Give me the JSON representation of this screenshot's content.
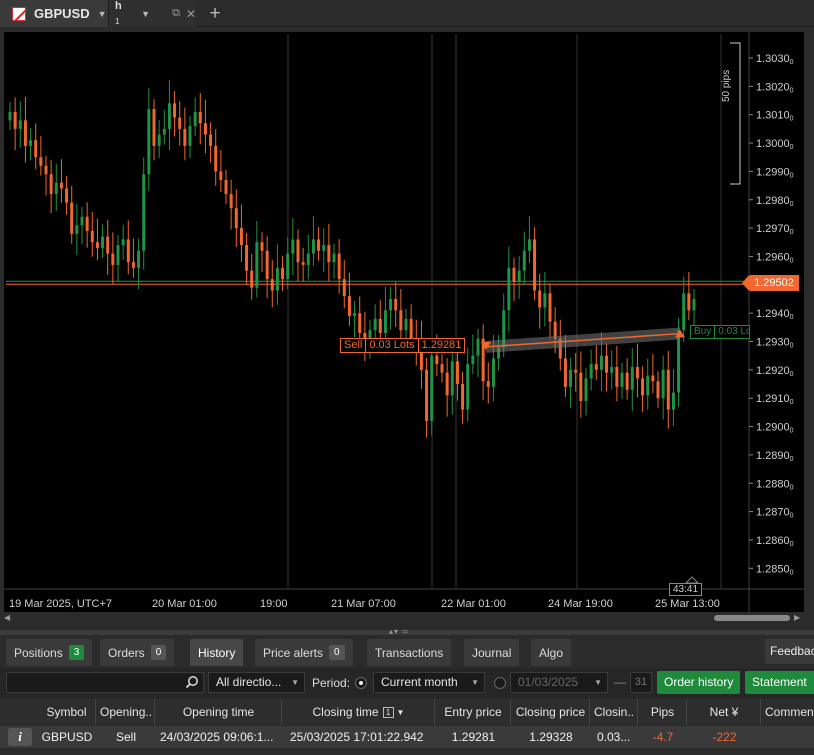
{
  "window": {
    "symbol_tab": "GBPUSD",
    "timeframe": "h",
    "timeframe_sub": "1"
  },
  "chart": {
    "current_price": "1.29502",
    "y_axis_labels": [
      "1.30300",
      "1.30200",
      "1.30100",
      "1.30000",
      "1.29900",
      "1.29800",
      "1.29700",
      "1.29600",
      "1.29500",
      "1.29400",
      "1.29300",
      "1.29200",
      "1.29100",
      "1.29000",
      "1.28900",
      "1.28800",
      "1.28700",
      "1.28600",
      "1.28500"
    ],
    "x_axis_labels": [
      "19 Mar 2025, UTC+7",
      "20 Mar 01:00",
      "19:00",
      "21 Mar 07:00",
      "22 Mar 01:00",
      "24 Mar 19:00",
      "25 Mar 13:00"
    ],
    "pips_ruler": "50 pips",
    "cursor_time": "43:41",
    "sell_marker": {
      "side": "Sell",
      "lots": "0.03 Lots",
      "price": "1.29281"
    },
    "buy_marker": {
      "side": "Buy",
      "lots": "0.03 Lo"
    },
    "colors": {
      "bull": "#1f9447",
      "bear": "#f06830",
      "background": "#000000",
      "grid": "#333333"
    }
  },
  "chart_data": {
    "type": "candlestick",
    "ylim": [
      1.2845,
      1.3035
    ],
    "current_price": 1.29502,
    "trade": {
      "entry_price": 1.29281,
      "closing_price": 1.29328,
      "entry_time": "24/03/2025 09:06",
      "closing_time": "25/03/2025 17:01"
    },
    "candles_close": [
      1.3011,
      1.3005,
      1.3008,
      1.2999,
      1.3001,
      1.2995,
      1.2992,
      1.2989,
      1.2982,
      1.2986,
      1.2984,
      1.2979,
      1.2968,
      1.2971,
      1.2974,
      1.2969,
      1.2965,
      1.2963,
      1.2967,
      1.2961,
      1.2957,
      1.2964,
      1.2966,
      1.2958,
      1.2956,
      1.2962,
      1.2989,
      1.3012,
      1.2999,
      1.3003,
      1.3005,
      1.3014,
      1.3009,
      1.3005,
      1.2999,
      1.3006,
      1.3011,
      1.3007,
      1.3003,
      1.2999,
      1.299,
      1.2987,
      1.2982,
      1.2977,
      1.297,
      1.2964,
      1.2955,
      1.2949,
      1.2965,
      1.2962,
      1.2952,
      1.2948,
      1.2956,
      1.2952,
      1.2961,
      1.2966,
      1.2958,
      1.2957,
      1.2961,
      1.2966,
      1.2962,
      1.2964,
      1.2958,
      1.2961,
      1.2952,
      1.2946,
      1.2939,
      1.294,
      1.2933,
      1.2929,
      1.2934,
      1.2938,
      1.2933,
      1.2941,
      1.2945,
      1.2941,
      1.2934,
      1.2938,
      1.2931,
      1.2929,
      1.292,
      1.2902,
      1.2925,
      1.2922,
      1.2919,
      1.2911,
      1.2923,
      1.2915,
      1.2906,
      1.2922,
      1.2925,
      1.2931,
      1.2916,
      1.2914,
      1.2924,
      1.2928,
      1.2941,
      1.2956,
      1.2951,
      1.2955,
      1.2962,
      1.2966,
      1.2948,
      1.2942,
      1.2947,
      1.2937,
      1.2931,
      1.2924,
      1.2914,
      1.292,
      1.2919,
      1.2909,
      1.2917,
      1.2922,
      1.292,
      1.2925,
      1.2919,
      1.2921,
      1.2914,
      1.2919,
      1.2913,
      1.2921,
      1.2917,
      1.2911,
      1.2918,
      1.2916,
      1.291,
      1.292,
      1.2906,
      1.2912,
      1.2934,
      1.2947,
      1.2941,
      1.2945
    ]
  },
  "bottom_tabs": [
    {
      "label": "Positions",
      "badge": "3"
    },
    {
      "label": "Orders",
      "badge": "0"
    },
    {
      "label": "History"
    },
    {
      "label": "Price alerts",
      "badge": "0"
    },
    {
      "label": "Transactions"
    },
    {
      "label": "Journal"
    },
    {
      "label": "Algo"
    }
  ],
  "feedback_label": "Feedbac",
  "filters": {
    "search_value": "",
    "direction": "All directio...",
    "period_label": "Period:",
    "period_value": "Current month",
    "date_from": "01/03/2025",
    "date_sep": "—",
    "calendar": "31",
    "order_history_btn": "Order history",
    "statement_btn": "Statement"
  },
  "table": {
    "headers": [
      "Symbol",
      "Opening..",
      "Opening time",
      "Closing time",
      "Entry price",
      "Closing price",
      "Closin..",
      "Pips",
      "Net ¥",
      "Commen"
    ],
    "sort_badge": "1",
    "rows": [
      {
        "info": "i",
        "symbol": "GBPUSD",
        "direction": "Sell",
        "opening_time": "24/03/2025 09:06:1...",
        "closing_time": "25/03/2025 17:01:22.942",
        "entry_price": "1.29281",
        "closing_price": "1.29328",
        "closing_qty": "0.03...",
        "pips": "-4.7",
        "net": "-222",
        "comment": ""
      }
    ]
  }
}
